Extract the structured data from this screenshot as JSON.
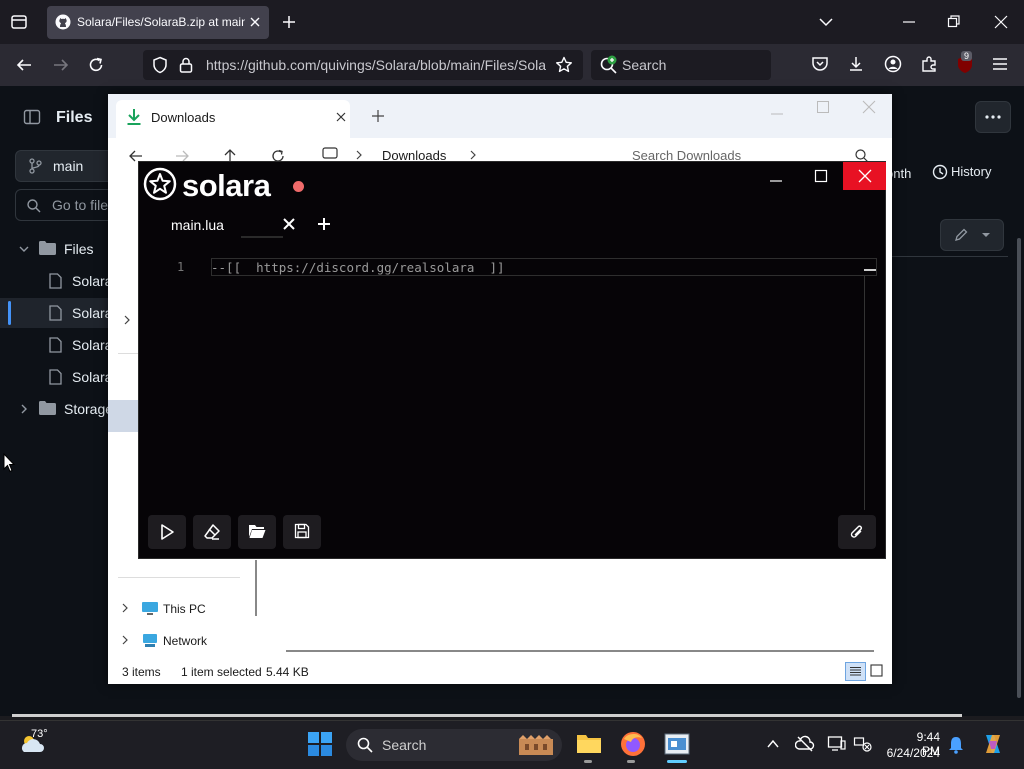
{
  "browser": {
    "tab_title": "Solara/Files/SolaraB.zip at main",
    "url": "https://github.com/quivings/Solara/blob/main/Files/Sola",
    "search_placeholder": "Search",
    "extension_badge": "9"
  },
  "github": {
    "sidebar_title": "Files",
    "branch": "main",
    "go_to_file_placeholder": "Go to file",
    "tree": [
      {
        "label": "Files"
      },
      {
        "label": "Solara"
      },
      {
        "label": "Solara"
      },
      {
        "label": "Solara"
      },
      {
        "label": "Solara"
      },
      {
        "label": "Storage"
      }
    ],
    "month_label": "onth",
    "history_label": "History"
  },
  "explorer": {
    "tab_label": "Downloads",
    "breadcrumb": "Downloads",
    "search_placeholder": "Search Downloads",
    "nav_this_pc": "This PC",
    "nav_network": "Network",
    "status_items": "3 items",
    "status_selected": "1 item selected",
    "status_size": "5.44 KB"
  },
  "solara": {
    "app_name": "solara",
    "accent": "#ef6a6a",
    "tab_label": "main.lua",
    "line_number": "1",
    "code": "--[[  https://discord.gg/realsolara  ]]"
  },
  "taskbar": {
    "temperature": "73°",
    "search_label": "Search",
    "time": "9:44 PM",
    "date": "6/24/2024"
  }
}
